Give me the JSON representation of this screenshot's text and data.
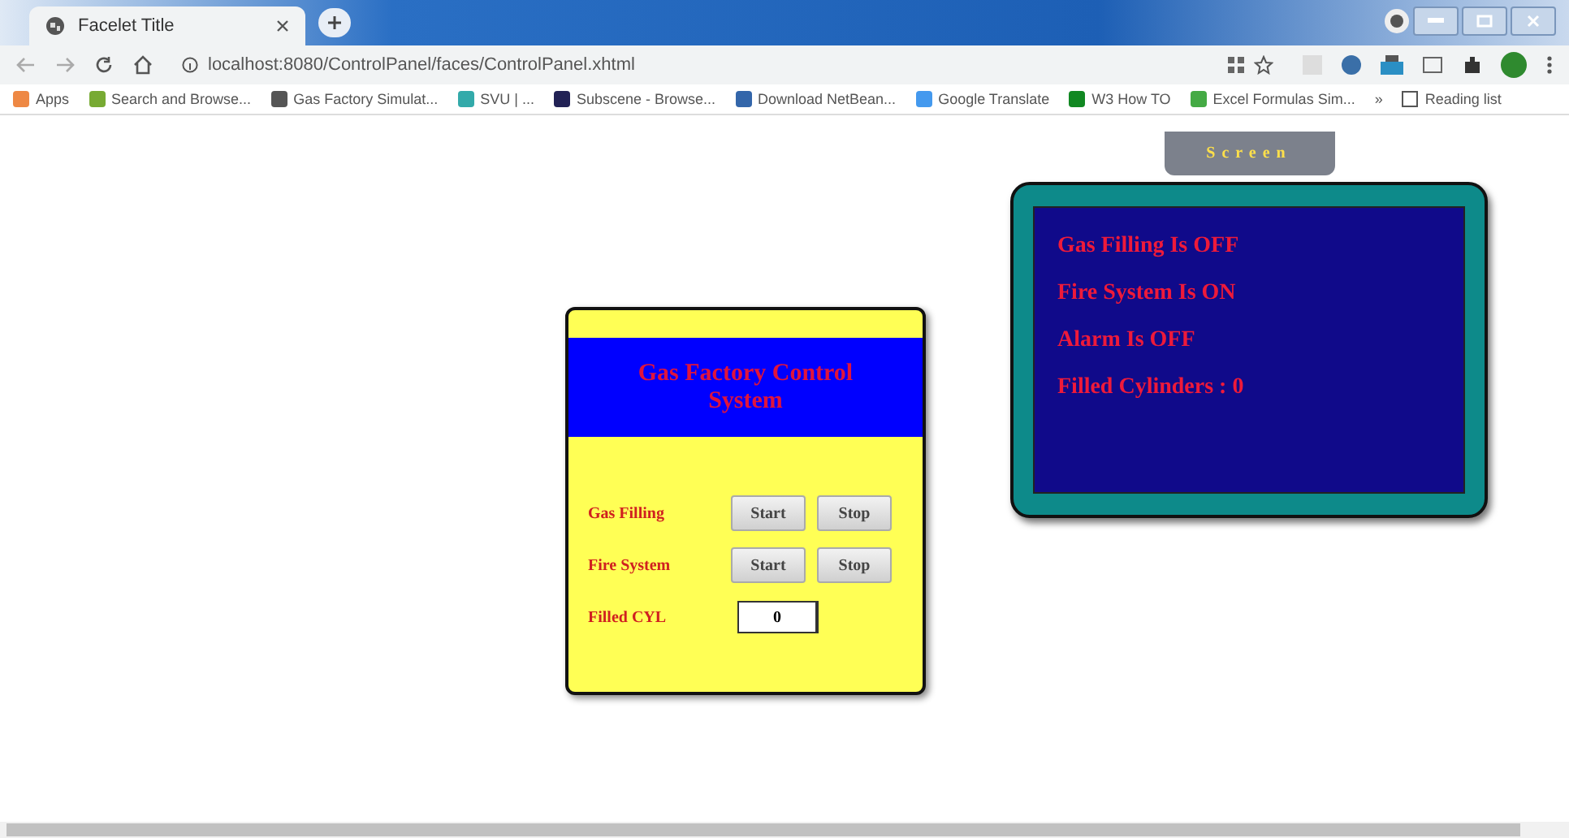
{
  "browser": {
    "tab_title": "Facelet Title",
    "url": "localhost:8080/ControlPanel/faces/ControlPanel.xhtml",
    "bookmarks": [
      "Apps",
      "Search and Browse...",
      "Gas Factory Simulat...",
      "SVU | ...",
      "Subscene - Browse...",
      "Download NetBean...",
      "Google Translate",
      "W3 How TO",
      "Excel Formulas Sim..."
    ],
    "more": "»",
    "reading_list": "Reading list"
  },
  "control_panel": {
    "title": "Gas Factory Control System",
    "rows": [
      {
        "label": "Gas Filling",
        "kind": "buttons",
        "buttons": [
          "Start",
          "Stop"
        ]
      },
      {
        "label": "Fire System",
        "kind": "buttons",
        "buttons": [
          "Start",
          "Stop"
        ]
      },
      {
        "label": "Filled CYL",
        "kind": "field",
        "value": "0"
      }
    ]
  },
  "screen": {
    "button": "Screen",
    "lines": [
      "Gas Filling Is OFF",
      "Fire System Is ON",
      "Alarm Is OFF",
      "Filled Cylinders : 0"
    ]
  }
}
